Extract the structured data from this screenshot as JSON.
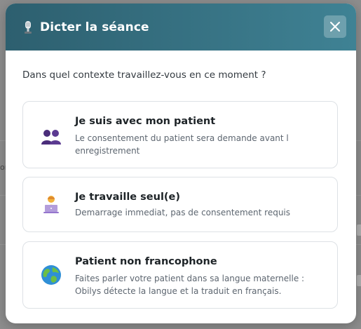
{
  "modal": {
    "title": "Dicter la séance",
    "close_label": "×"
  },
  "prompt": "Dans quel contexte travaillez-vous en ce moment ?",
  "options": [
    {
      "title": "Je suis avec mon patient",
      "description": "Le consentement du patient sera demande avant l enregistrement",
      "icon": "two-people-icon"
    },
    {
      "title": "Je travaille seul(e)",
      "description": "Demarrage immediat, pas de consentement requis",
      "icon": "person-at-laptop-icon"
    },
    {
      "title": "Patient non francophone",
      "description": "Faites parler votre patient dans sa langue maternelle : Obilys détecte la langue et la traduit en français.",
      "icon": "globe-icon"
    }
  ],
  "background": {
    "edge_text": "on"
  },
  "colors": {
    "header_start": "#2d5f6f",
    "header_end": "#3f8294",
    "card_border": "#dde1e5",
    "overlay": "#8e8e8e"
  }
}
